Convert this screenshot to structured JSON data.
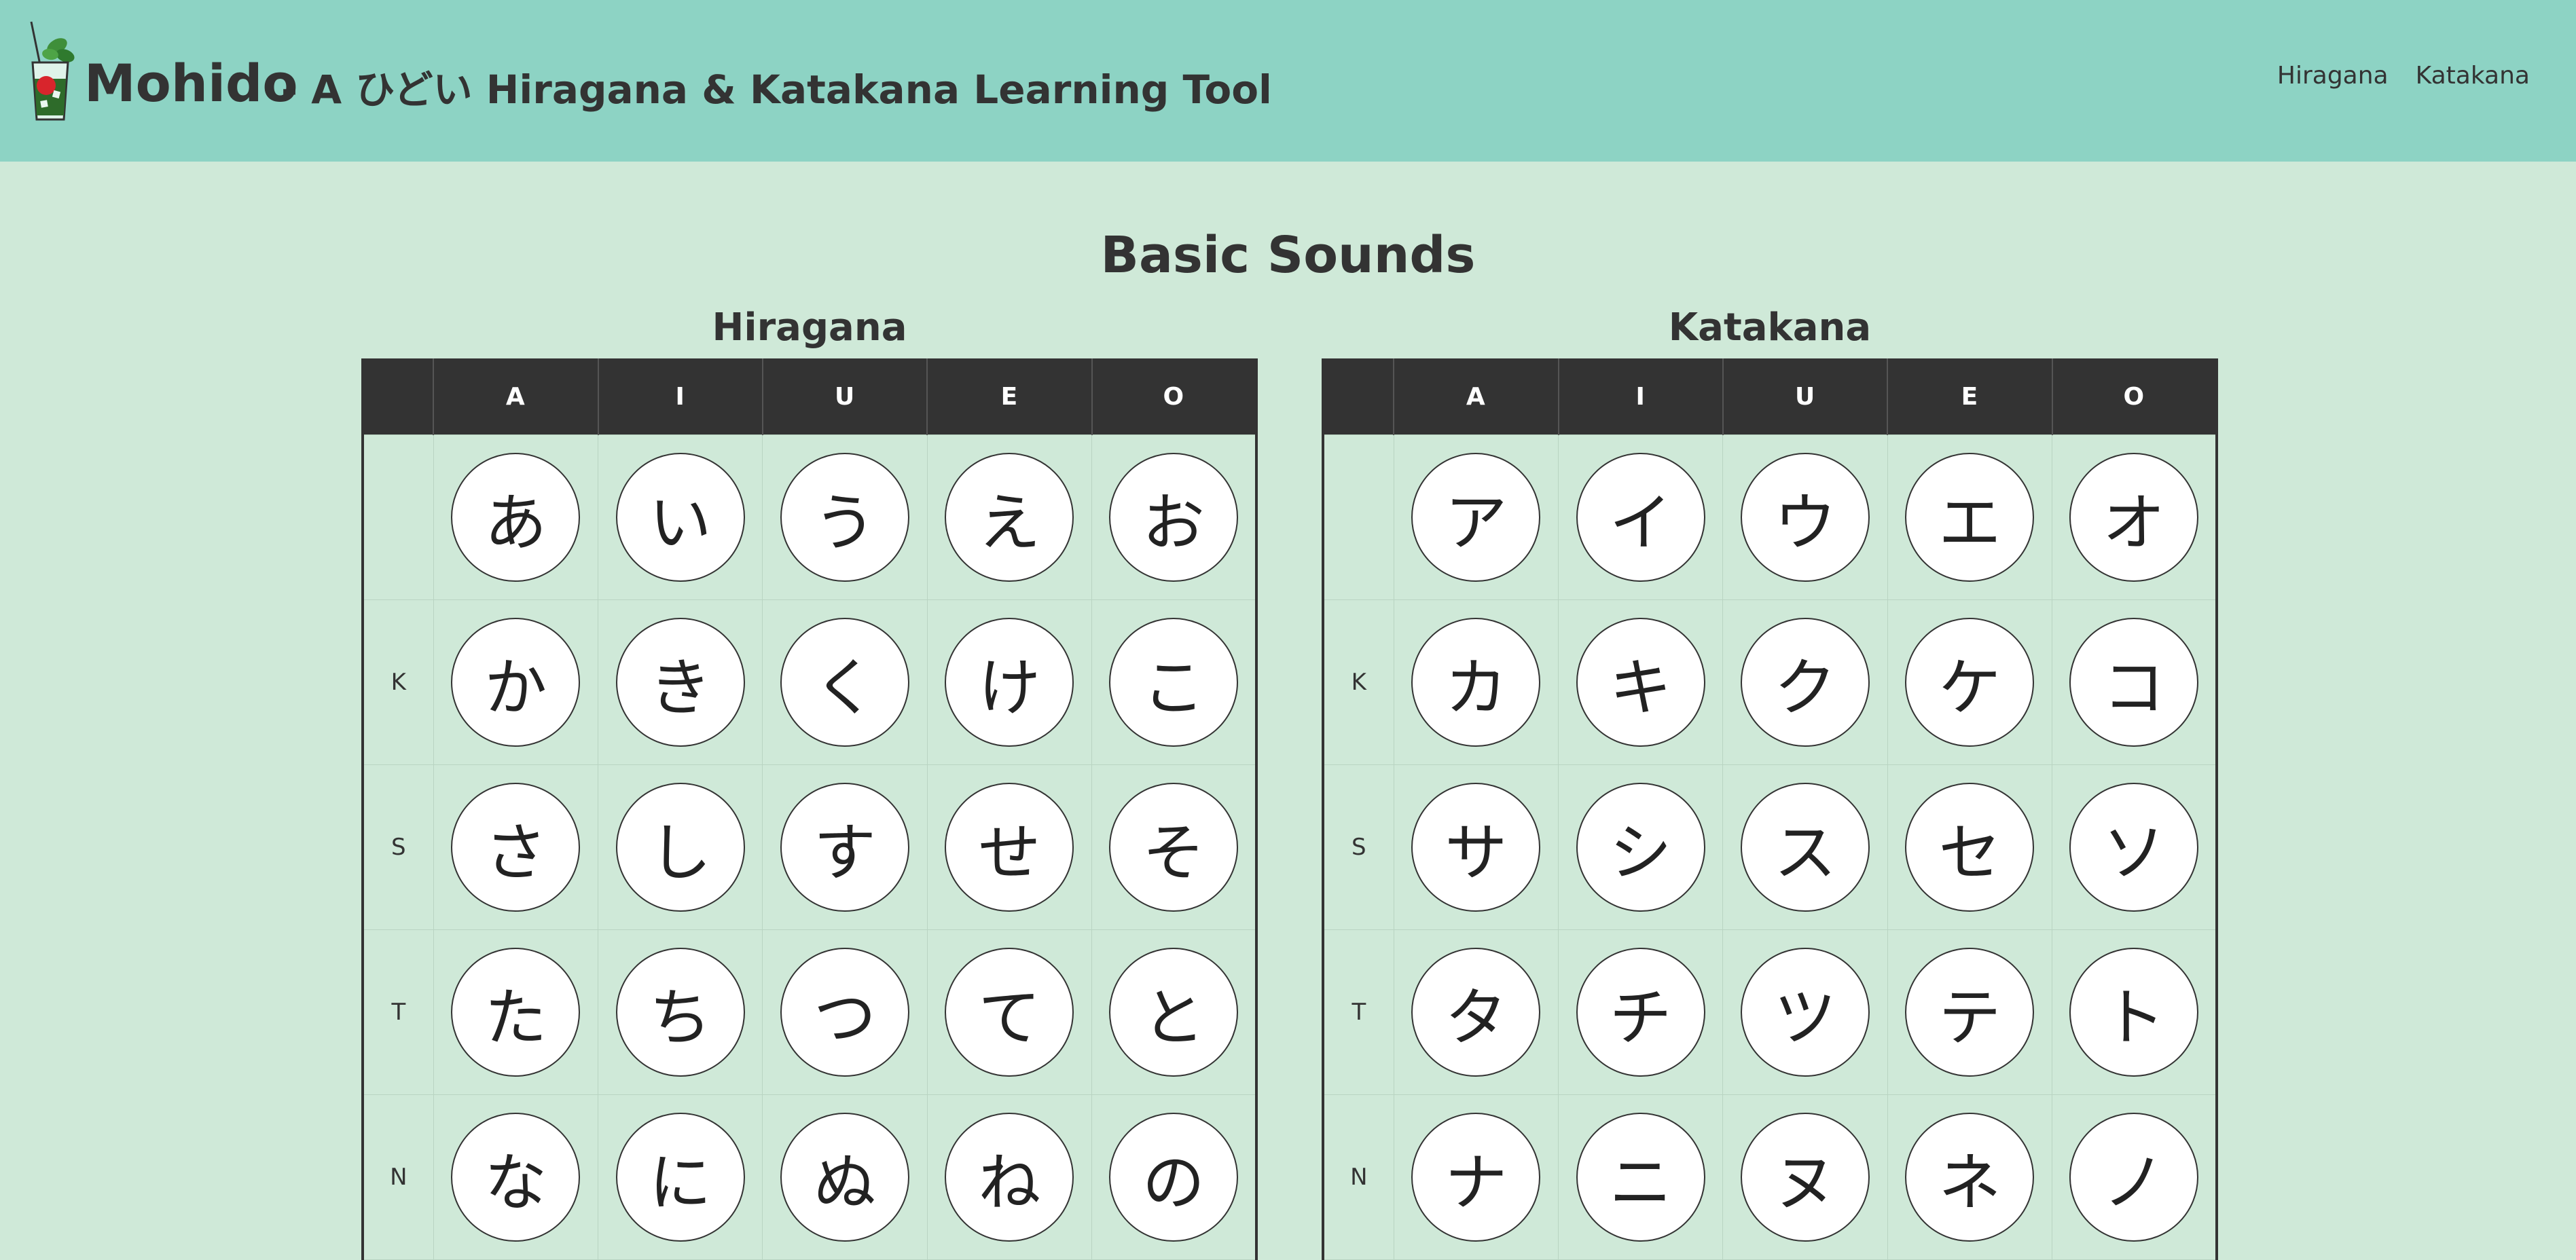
{
  "header": {
    "brand": "Mohido",
    "tagline": "- A ひどい Hiragana & Katakana Learning Tool",
    "logo_icon": "mojito-glass-icon",
    "background_color": "#8dd3c4",
    "nav": [
      {
        "label": "Hiragana"
      },
      {
        "label": "Katakana"
      }
    ]
  },
  "page": {
    "title": "Basic Sounds",
    "background_color": "#cfe9d8"
  },
  "tables": {
    "columns": [
      "A",
      "I",
      "U",
      "E",
      "O"
    ],
    "row_labels": [
      "",
      "K",
      "S",
      "T",
      "N"
    ],
    "hiragana": {
      "title": "Hiragana",
      "rows": [
        [
          "あ",
          "い",
          "う",
          "え",
          "お"
        ],
        [
          "か",
          "き",
          "く",
          "け",
          "こ"
        ],
        [
          "さ",
          "し",
          "す",
          "せ",
          "そ"
        ],
        [
          "た",
          "ち",
          "つ",
          "て",
          "と"
        ],
        [
          "な",
          "に",
          "ぬ",
          "ね",
          "の"
        ]
      ]
    },
    "katakana": {
      "title": "Katakana",
      "rows": [
        [
          "ア",
          "イ",
          "ウ",
          "エ",
          "オ"
        ],
        [
          "カ",
          "キ",
          "ク",
          "ケ",
          "コ"
        ],
        [
          "サ",
          "シ",
          "ス",
          "セ",
          "ソ"
        ],
        [
          "タ",
          "チ",
          "ツ",
          "テ",
          "ト"
        ],
        [
          "ナ",
          "ニ",
          "ヌ",
          "ネ",
          "ノ"
        ]
      ]
    }
  }
}
